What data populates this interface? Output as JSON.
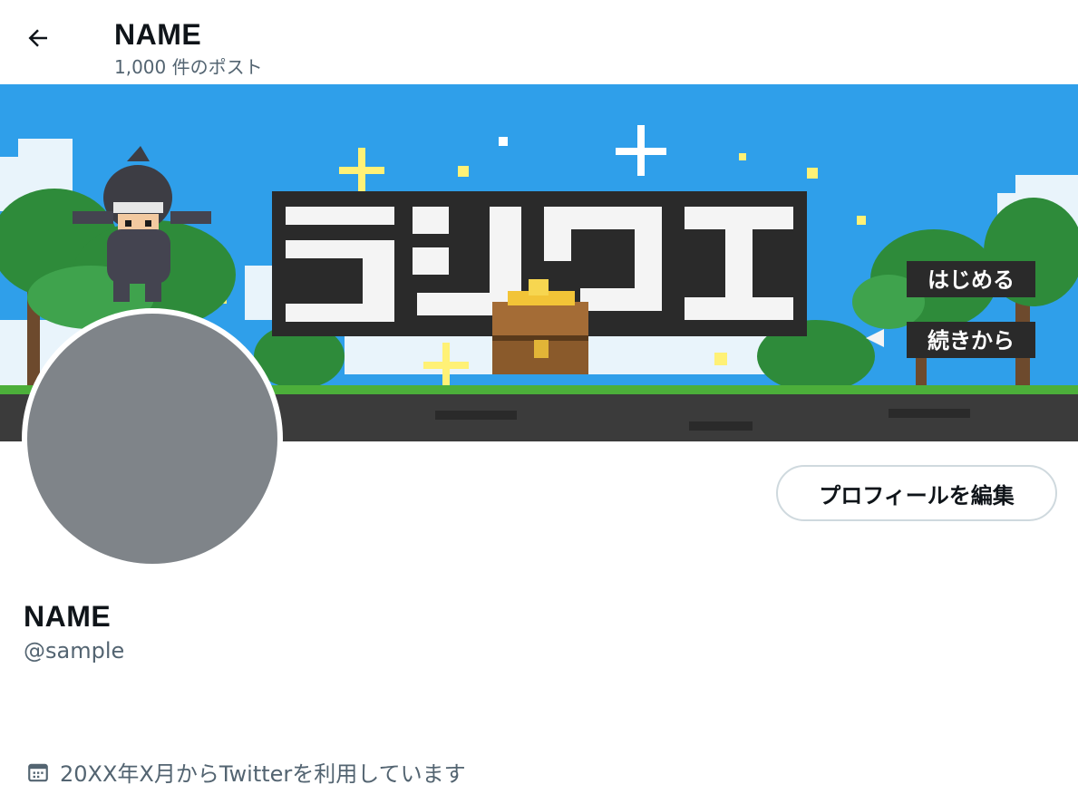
{
  "header": {
    "title": "NAME",
    "post_count": "1,000 件のポスト",
    "back_icon": "arrow-left-icon"
  },
  "banner": {
    "title_text": "ランクエ",
    "menu_items": [
      "はじめる",
      "続きから"
    ],
    "colors": {
      "sky": "#2f9fea",
      "ground": "#3b3b3b",
      "grass": "#4caf3a",
      "tree": "#2e8b3a"
    }
  },
  "avatar": {
    "color": "#7f8489"
  },
  "actions": {
    "edit_profile_label": "プロフィールを編集"
  },
  "profile": {
    "name": "NAME",
    "handle": "@sample",
    "joined": "20XX年X月からTwitterを利用しています",
    "joined_icon": "calendar-icon"
  }
}
